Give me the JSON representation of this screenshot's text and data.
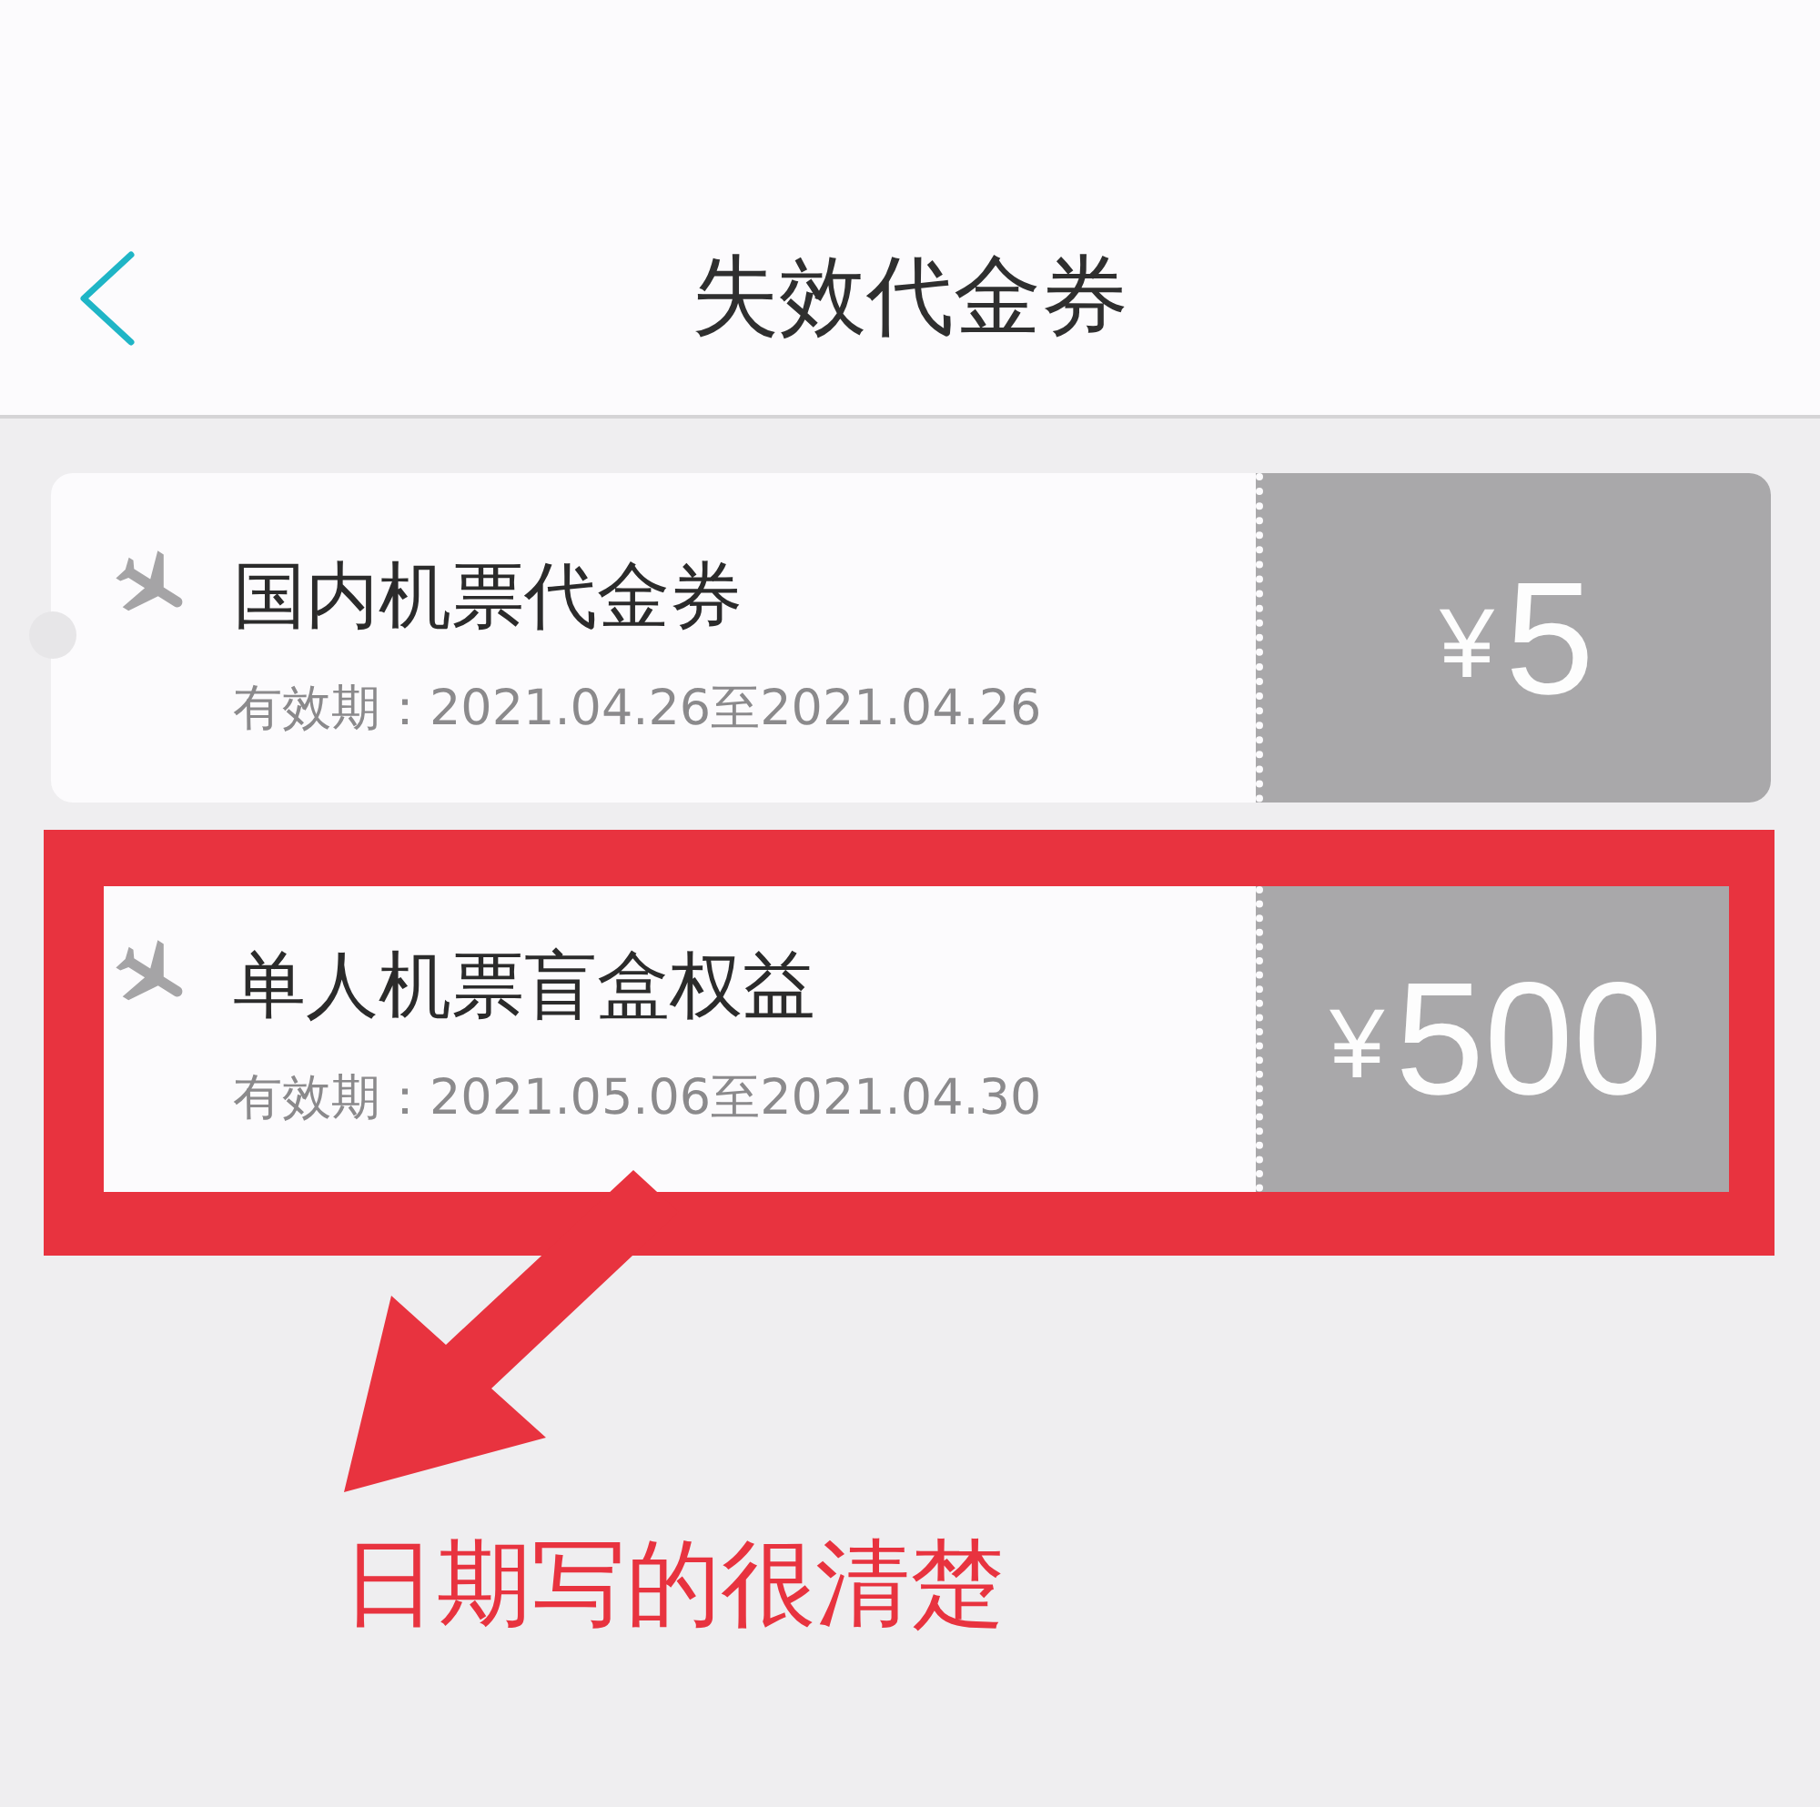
{
  "header": {
    "title": "失效代金券"
  },
  "vouchers": [
    {
      "title": "国内机票代金券",
      "validity": "有效期：2021.04.26至2021.04.26",
      "currency": "¥",
      "amount": "5",
      "highlighted": false
    },
    {
      "title": "单人机票盲盒权益",
      "validity": "有效期：2021.05.06至2021.04.30",
      "currency": "¥",
      "amount": "500",
      "highlighted": true
    }
  ],
  "annotation": {
    "text": "日期写的很清楚"
  }
}
